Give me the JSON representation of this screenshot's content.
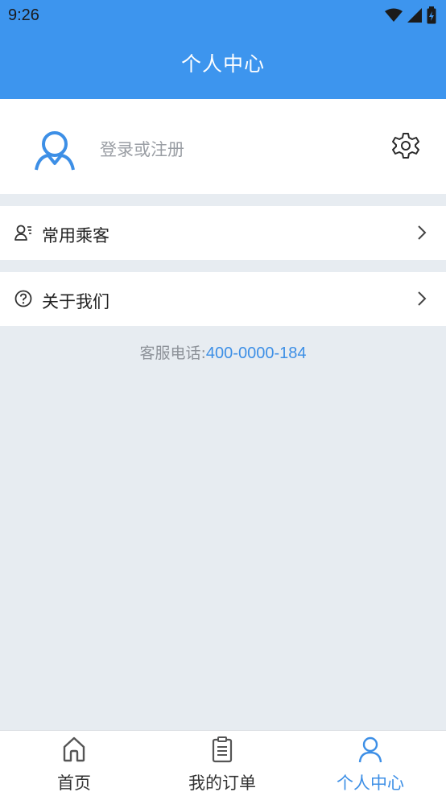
{
  "status_bar": {
    "time": "9:26"
  },
  "header": {
    "title": "个人中心"
  },
  "profile": {
    "login_prompt": "登录或注册",
    "avatar_icon": "user-avatar-icon",
    "settings_icon": "gear-icon"
  },
  "menu": [
    {
      "label": "常用乘客",
      "icon": "passenger-list-icon"
    },
    {
      "label": "关于我们",
      "icon": "question-circle-icon"
    }
  ],
  "service": {
    "label": "客服电话:",
    "phone": "400-0000-184"
  },
  "tabs": [
    {
      "label": "首页",
      "icon": "home-icon",
      "active": false
    },
    {
      "label": "我的订单",
      "icon": "clipboard-icon",
      "active": false
    },
    {
      "label": "个人中心",
      "icon": "person-icon",
      "active": true
    }
  ],
  "colors": {
    "primary": "#3d95ee",
    "background": "#e7ecf1",
    "accent_text": "#3d8fe6"
  }
}
